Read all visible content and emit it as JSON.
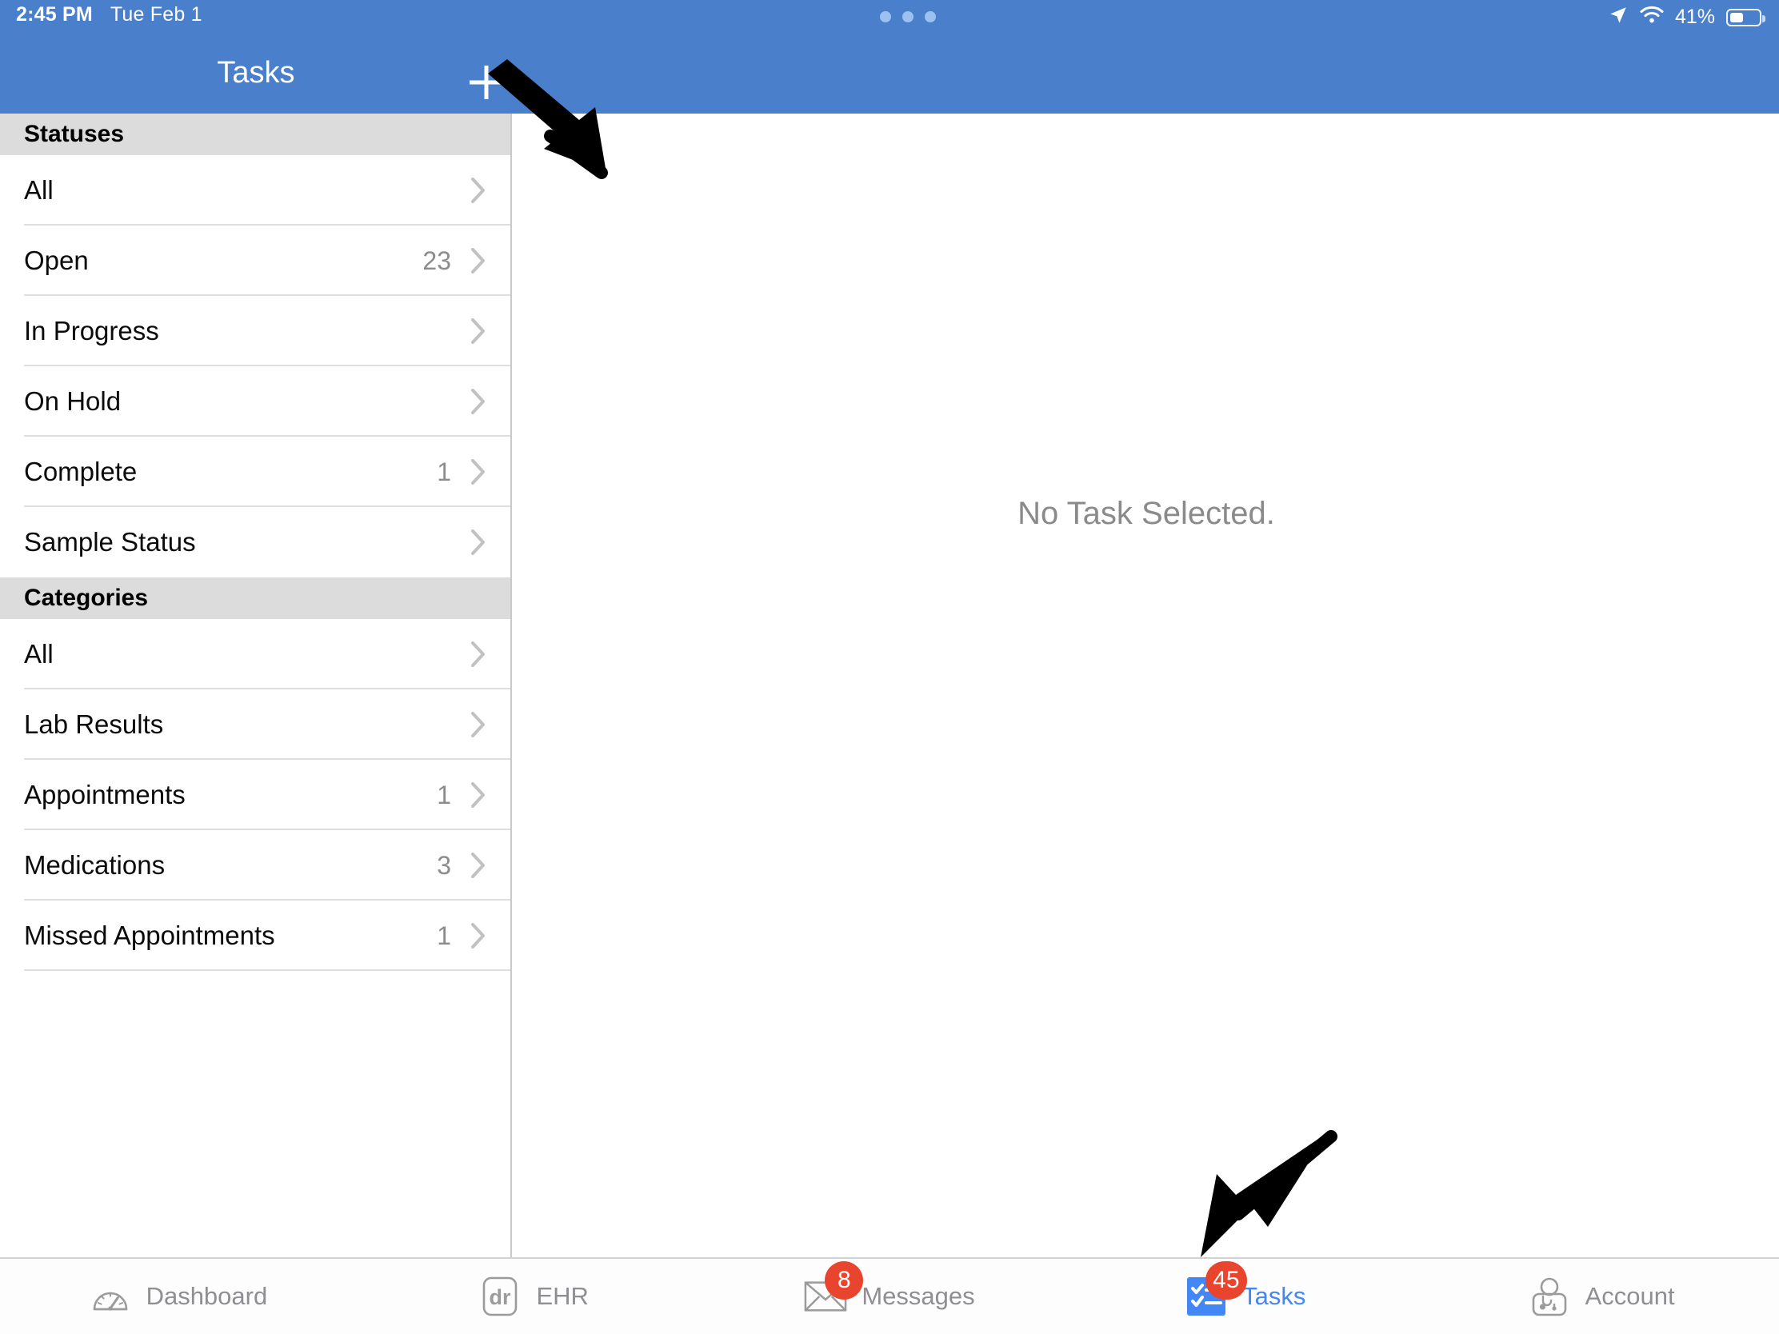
{
  "status_bar": {
    "time": "2:45 PM",
    "date": "Tue Feb 1",
    "battery_percent": "41%",
    "icons": [
      "location-arrow-icon",
      "wifi-icon",
      "battery-icon"
    ],
    "multitask_dots": "•••"
  },
  "nav": {
    "title": "Tasks",
    "add_button_label": "+"
  },
  "sidebar": {
    "sections": [
      {
        "header": "Statuses",
        "items": [
          {
            "label": "All",
            "count": ""
          },
          {
            "label": "Open",
            "count": "23"
          },
          {
            "label": "In Progress",
            "count": ""
          },
          {
            "label": "On Hold",
            "count": ""
          },
          {
            "label": "Complete",
            "count": "1"
          },
          {
            "label": "Sample Status",
            "count": ""
          }
        ]
      },
      {
        "header": "Categories",
        "items": [
          {
            "label": "All",
            "count": ""
          },
          {
            "label": "Lab Results",
            "count": ""
          },
          {
            "label": "Appointments",
            "count": "1"
          },
          {
            "label": "Medications",
            "count": "3"
          },
          {
            "label": "Missed Appointments",
            "count": "1"
          }
        ]
      }
    ]
  },
  "detail": {
    "empty_message": "No Task Selected."
  },
  "tabbar": {
    "tabs": [
      {
        "label": "Dashboard",
        "icon": "gauge-icon",
        "badge": "",
        "active": false
      },
      {
        "label": "EHR",
        "icon": "dr-card-icon",
        "badge": "",
        "active": false
      },
      {
        "label": "Messages",
        "icon": "envelope-icon",
        "badge": "8",
        "active": false
      },
      {
        "label": "Tasks",
        "icon": "checklist-icon",
        "badge": "45",
        "active": true
      },
      {
        "label": "Account",
        "icon": "doctor-icon",
        "badge": "",
        "active": false
      }
    ]
  },
  "colors": {
    "header_blue": "#4a7fcb",
    "accent_blue": "#4287f5",
    "badge_red": "#e8442e",
    "section_gray": "#dcdcdc",
    "inactive_gray": "#8e8e93"
  },
  "annotations": [
    {
      "name": "arrow-to-add-button",
      "points_to": "add-task-button"
    },
    {
      "name": "arrow-to-tasks-tab",
      "points_to": "tab-tasks"
    }
  ]
}
